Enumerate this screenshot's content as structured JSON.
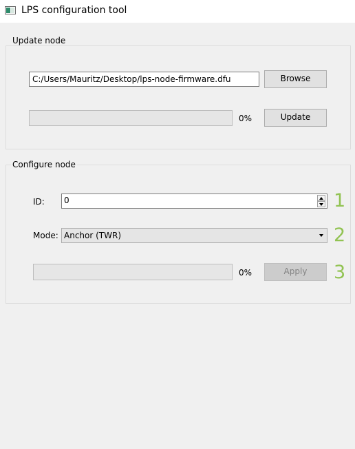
{
  "window": {
    "title": "LPS configuration tool",
    "icon": "app-window-icon"
  },
  "update_node": {
    "group_title": "Update node",
    "file_path": "C:/Users/Mauritz/Desktop/lps-node-firmware.dfu",
    "browse_label": "Browse",
    "progress_percent": 0,
    "progress_text": "0%",
    "update_label": "Update"
  },
  "configure_node": {
    "group_title": "Configure node",
    "id_label": "ID:",
    "id_value": "0",
    "mode_label": "Mode:",
    "mode_value": "Anchor (TWR)",
    "progress_percent": 0,
    "progress_text": "0%",
    "apply_label": "Apply"
  },
  "annotations": [
    "1",
    "2",
    "3"
  ],
  "colors": {
    "annotation": "#92c353",
    "progress_fill": "#06b025"
  }
}
